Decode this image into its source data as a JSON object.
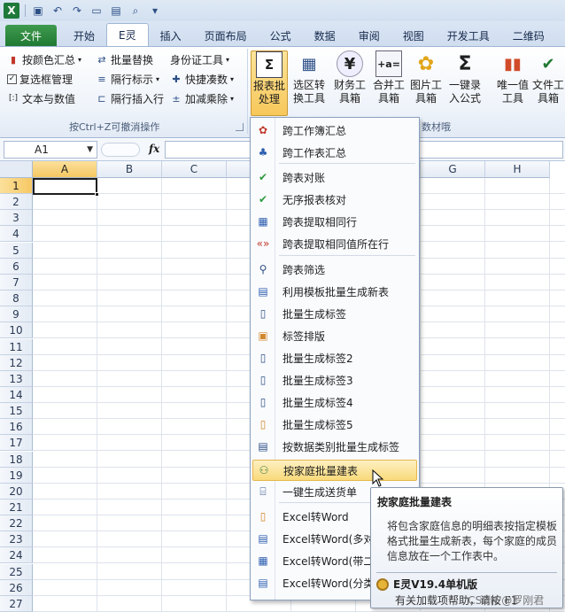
{
  "qat": {
    "app_icon": "X"
  },
  "tabs": [
    "文件",
    "开始",
    "E灵",
    "插入",
    "页面布局",
    "公式",
    "数据",
    "审阅",
    "视图",
    "开发工具",
    "二维码"
  ],
  "ribbon": {
    "group1": {
      "buttons": {
        "color_sum": "按颜色汇总",
        "batch_replace": "批量替换",
        "id_tool": "身份证工具",
        "checkbox_mgr": "复选框管理",
        "alt_row_mark": "隔行标示",
        "quick_count": "快捷凑数",
        "text_number": "文本与数值",
        "alt_insert_row": "隔行插入行",
        "add_sub_mul_div": "加减乘除"
      },
      "label": "按Ctrl+Z可撤消操作"
    },
    "big": {
      "report_batch": [
        "报表批",
        "处理"
      ],
      "range_convert": [
        "选区转",
        "换工具"
      ],
      "finance_tool": [
        "财务工",
        "具箱"
      ],
      "merge_tool": [
        "合并工",
        "具箱"
      ],
      "image_tool": [
        "图片工",
        "具箱"
      ],
      "one_key_formula": [
        "一键录",
        "入公式"
      ],
      "unique_tool": [
        "唯一值",
        "工具"
      ],
      "file_tool": [
        "文件工",
        "具箱"
      ]
    },
    "group2_label_partial": "数材哦"
  },
  "formula_bar": {
    "name_box": "A1",
    "fx": "fx",
    "formula": ""
  },
  "grid": {
    "columns": [
      "A",
      "B",
      "C",
      "D",
      "E",
      "F",
      "G",
      "H"
    ],
    "rows": [
      "1",
      "2",
      "3",
      "4",
      "5",
      "6",
      "7",
      "8",
      "9",
      "10",
      "11",
      "12",
      "13",
      "14",
      "15",
      "16",
      "17",
      "18",
      "19",
      "20",
      "21",
      "22",
      "23",
      "24",
      "25",
      "26",
      "27"
    ]
  },
  "menu": {
    "items": [
      "跨工作簿汇总",
      "跨工作表汇总",
      "跨表对账",
      "无序报表核对",
      "跨表提取相同行",
      "跨表提取相同值所在行",
      "跨表筛选",
      "利用模板批量生成新表",
      "批量生成标签",
      "标签排版",
      "批量生成标签2",
      "批量生成标签3",
      "批量生成标签4",
      "批量生成标签5",
      "按数据类别批量生成标签",
      "按家庭批量建表",
      "一键生成送货单",
      "Excel转Word",
      "Excel转Word(多对",
      "Excel转Word(带二",
      "Excel转Word(分类"
    ]
  },
  "tooltip": {
    "title": "按家庭批量建表",
    "body": "将包含家庭信息的明细表按指定模板格式批量生成新表，每个家庭的成员信息放在一个工作表中。",
    "footer_title": "E灵V19.4单机版",
    "help": "有关加载项帮助，请按 F1",
    "watermark": "CSDN @罗刚君"
  },
  "colors": {
    "accent": "#217a33",
    "highlight": "#f9d97a",
    "ribbon_bg": "#eef3fa"
  }
}
